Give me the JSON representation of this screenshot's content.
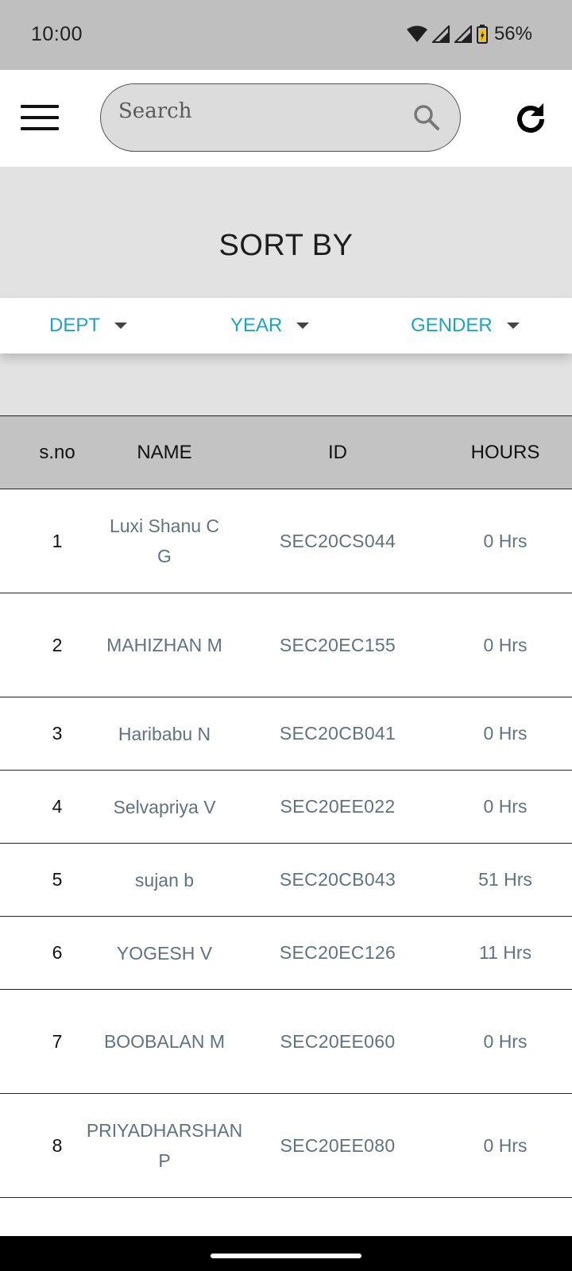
{
  "status_bar": {
    "time": "10:00",
    "battery": "56%"
  },
  "search": {
    "placeholder": "Search"
  },
  "sort": {
    "title": "SORT BY",
    "filters": [
      {
        "label": "DEPT"
      },
      {
        "label": "YEAR"
      },
      {
        "label": "GENDER"
      }
    ],
    "accent_color": "#1aa6bc"
  },
  "table": {
    "headers": {
      "sno": "s.no",
      "name": "NAME",
      "id": "ID",
      "hours": "HOURS"
    },
    "rows": [
      {
        "sno": "1",
        "name": "Luxi Shanu C G",
        "id": "SEC20CS044",
        "hours": "0 Hrs"
      },
      {
        "sno": "2",
        "name": "MAHIZHAN M",
        "id": "SEC20EC155",
        "hours": "0 Hrs"
      },
      {
        "sno": "3",
        "name": "Haribabu N",
        "id": "SEC20CB041",
        "hours": "0 Hrs"
      },
      {
        "sno": "4",
        "name": "Selvapriya V",
        "id": "SEC20EE022",
        "hours": "0 Hrs"
      },
      {
        "sno": "5",
        "name": "sujan b",
        "id": "SEC20CB043",
        "hours": "51 Hrs"
      },
      {
        "sno": "6",
        "name": "YOGESH V",
        "id": "SEC20EC126",
        "hours": "11 Hrs"
      },
      {
        "sno": "7",
        "name": "BOOBALAN M",
        "id": "SEC20EE060",
        "hours": "0 Hrs"
      },
      {
        "sno": "8",
        "name": "PRIYADHARSHAN P",
        "id": "SEC20EE080",
        "hours": "0 Hrs"
      }
    ]
  }
}
